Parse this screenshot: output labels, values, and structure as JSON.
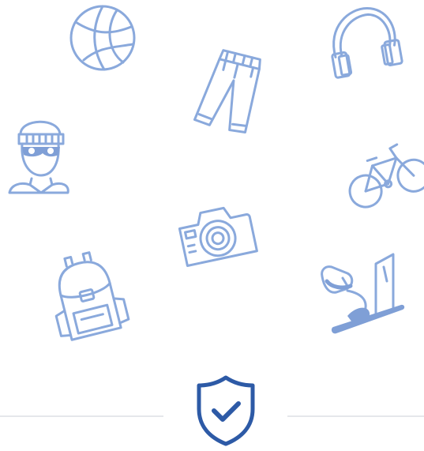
{
  "colors": {
    "icon_stroke": "#8aa9dc",
    "icon_fill": "#7f9fd6",
    "shield_stroke": "#2d5aa6",
    "divider": "#e5e7eb",
    "background": "#ffffff"
  },
  "icons": [
    "basketball-icon",
    "jeans-icon",
    "headphones-icon",
    "burglar-icon",
    "bicycle-icon",
    "camera-icon",
    "backpack-icon",
    "desk-lamp-icon",
    "shield-check-icon"
  ]
}
